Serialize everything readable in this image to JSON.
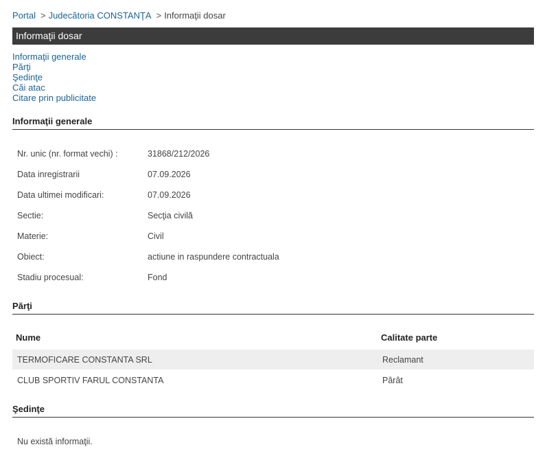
{
  "breadcrumb": {
    "portal": "Portal",
    "court": "Judecătoria CONSTANŢA",
    "current": "Informaţii dosar",
    "sep": ">"
  },
  "title": "Informaţii dosar",
  "menu": [
    "Informaţii generale",
    "Părţi",
    "Şedinţe",
    "Căi atac",
    "Citare prin publicitate"
  ],
  "general": {
    "heading": "Informaţii generale",
    "rows": [
      {
        "label": "Nr. unic (nr. format vechi) :",
        "value": "31868/212/2026"
      },
      {
        "label": "Data inregistrarii",
        "value": "07.09.2026"
      },
      {
        "label": "Data ultimei modificari:",
        "value": "07.09.2026"
      },
      {
        "label": "Sectie:",
        "value": "Secţia civilă"
      },
      {
        "label": "Materie:",
        "value": "Civil"
      },
      {
        "label": "Obiect:",
        "value": "actiune in raspundere contractuala"
      },
      {
        "label": "Stadiu procesual:",
        "value": "Fond"
      }
    ]
  },
  "parti": {
    "heading": "Părţi",
    "columns": [
      "Nume",
      "Calitate parte"
    ],
    "rows": [
      {
        "name": "TERMOFICARE CONSTANTA SRL",
        "role": "Reclamant"
      },
      {
        "name": "CLUB SPORTIV FARUL CONSTANTA",
        "role": "Pârât"
      }
    ]
  },
  "sedinte": {
    "heading": "Şedinţe",
    "empty_text": "Nu există informaţii."
  }
}
